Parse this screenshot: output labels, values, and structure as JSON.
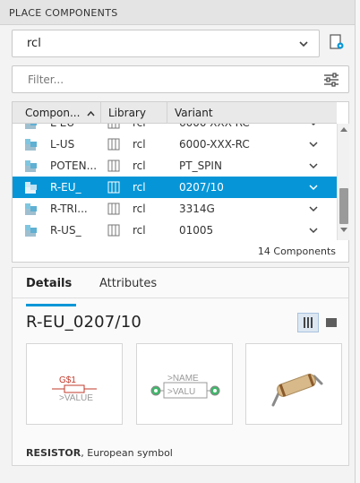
{
  "panel": {
    "title": "PLACE COMPONENTS"
  },
  "search": {
    "value": "rcl"
  },
  "filter": {
    "placeholder": "Filter..."
  },
  "table": {
    "headers": [
      "Compon...",
      "Library",
      "Variant"
    ],
    "partial_top_variant": "6000-XXX-RC",
    "rows": [
      {
        "name": "L-US",
        "library": "rcl",
        "variant": "6000-XXX-RC",
        "selected": false
      },
      {
        "name": "POTEN...",
        "library": "rcl",
        "variant": "PT_SPIN",
        "selected": false
      },
      {
        "name": "R-EU_",
        "library": "rcl",
        "variant": "0207/10",
        "selected": true
      },
      {
        "name": "R-TRI...",
        "library": "rcl",
        "variant": "3314G",
        "selected": false
      },
      {
        "name": "R-US_",
        "library": "rcl",
        "variant": "01005",
        "selected": false
      }
    ],
    "count": "14 Components"
  },
  "details": {
    "tabs": [
      "Details",
      "Attributes"
    ],
    "active_tab": "Details",
    "part_title": "R-EU_0207/10",
    "symbol": {
      "name": "G$1",
      "value": ">VALUE"
    },
    "footprint": {
      "name": ">NAME",
      "value": ">VALU"
    },
    "description_bold": "RESISTOR",
    "description_rest": ", European symbol"
  },
  "colors": {
    "accent": "#0696d7",
    "header_bg": "#e4e4e4",
    "resistor_red": "#c0392b"
  }
}
